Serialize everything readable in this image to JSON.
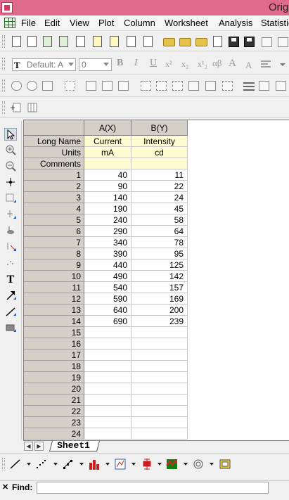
{
  "window": {
    "title": "Orig"
  },
  "menu": [
    "File",
    "Edit",
    "View",
    "Plot",
    "Column",
    "Worksheet",
    "Analysis",
    "Statistic"
  ],
  "format_toolbar": {
    "font_value": "Default: A",
    "size_value": "0",
    "bold": "B",
    "italic": "I",
    "underline": "U",
    "superscript": "x²",
    "subscript": "x₂",
    "supersub": "x¹₂",
    "greek": "αβ",
    "font_size_up": "A"
  },
  "worksheet": {
    "columns": [
      {
        "header": "A(X)",
        "long_name": "Current",
        "units": "mA",
        "comments": ""
      },
      {
        "header": "B(Y)",
        "long_name": "Intensity",
        "units": "cd",
        "comments": ""
      }
    ],
    "row_labels": {
      "long_name": "Long Name",
      "units": "Units",
      "comments": "Comments"
    },
    "rows": [
      {
        "n": "1",
        "a": "40",
        "b": "11"
      },
      {
        "n": "2",
        "a": "90",
        "b": "22"
      },
      {
        "n": "3",
        "a": "140",
        "b": "24"
      },
      {
        "n": "4",
        "a": "190",
        "b": "45"
      },
      {
        "n": "5",
        "a": "240",
        "b": "58"
      },
      {
        "n": "6",
        "a": "290",
        "b": "64"
      },
      {
        "n": "7",
        "a": "340",
        "b": "78"
      },
      {
        "n": "8",
        "a": "390",
        "b": "95"
      },
      {
        "n": "9",
        "a": "440",
        "b": "125"
      },
      {
        "n": "10",
        "a": "490",
        "b": "142"
      },
      {
        "n": "11",
        "a": "540",
        "b": "157"
      },
      {
        "n": "12",
        "a": "590",
        "b": "169"
      },
      {
        "n": "13",
        "a": "640",
        "b": "200"
      },
      {
        "n": "14",
        "a": "690",
        "b": "239"
      },
      {
        "n": "15",
        "a": "",
        "b": ""
      },
      {
        "n": "16",
        "a": "",
        "b": ""
      },
      {
        "n": "17",
        "a": "",
        "b": ""
      },
      {
        "n": "18",
        "a": "",
        "b": ""
      },
      {
        "n": "19",
        "a": "",
        "b": ""
      },
      {
        "n": "20",
        "a": "",
        "b": ""
      },
      {
        "n": "21",
        "a": "",
        "b": ""
      },
      {
        "n": "22",
        "a": "",
        "b": ""
      },
      {
        "n": "23",
        "a": "",
        "b": ""
      },
      {
        "n": "24",
        "a": "",
        "b": ""
      }
    ]
  },
  "sheet_tab": "Sheet1",
  "find": {
    "label": "Find:",
    "value": ""
  },
  "colors": {
    "titlebar": "#e06a8b",
    "label_rows": "#fdfcd0",
    "header_bg": "#d4d0c8"
  }
}
